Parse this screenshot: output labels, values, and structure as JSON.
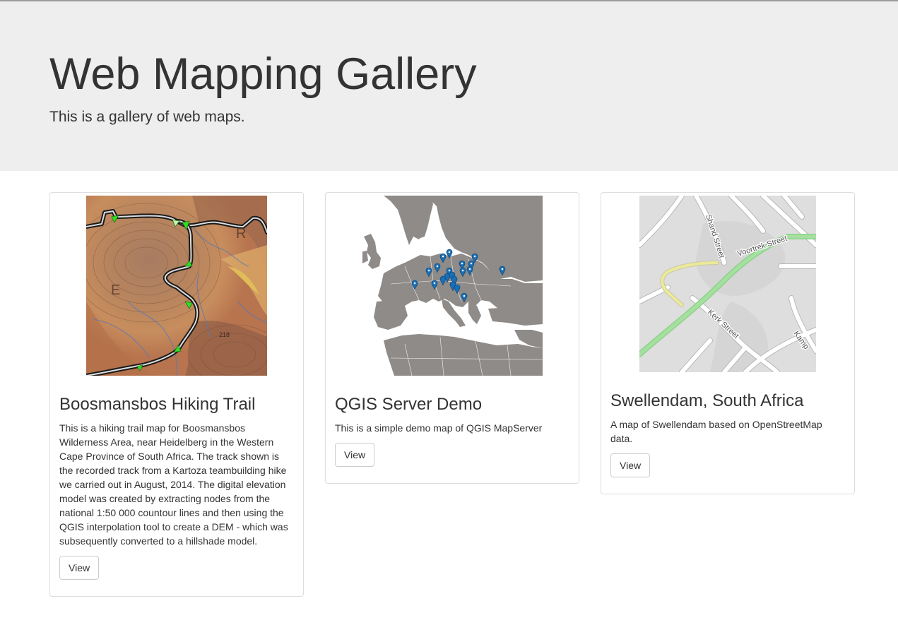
{
  "header": {
    "title": "Web Mapping Gallery",
    "subtitle": "This is a gallery of web maps."
  },
  "cards": [
    {
      "title": "Boosmansbos Hiking Trail",
      "description": "This is a hiking trail map for Boosmansbos Wilderness Area, near Heidelberg in the Western Cape Province of South Africa. The track shown is the recorded track from a Kartoza teambuilding hike we carried out in August, 2014. The digital elevation model was created by extracting nodes from the national 1:50 000 countour lines and then using the QGIS interpolation tool to create a DEM - which was subsequently converted to a hillshade model.",
      "button_label": "View",
      "image_labels": [
        "R",
        "E",
        "218"
      ]
    },
    {
      "title": "QGIS Server Demo",
      "description": "This is a simple demo map of QGIS MapServer",
      "button_label": "View"
    },
    {
      "title": "Swellendam, South Africa",
      "description": "A map of Swellendam based on OpenStreetMap data.",
      "button_label": "View",
      "image_labels": [
        "Shand Street",
        "Voortrek Street",
        "Kerk Street",
        "Kamp"
      ]
    }
  ],
  "colors": {
    "jumbotron_bg": "#eeeeee",
    "text": "#333333",
    "card_border": "#dddddd",
    "button_border": "#cccccc",
    "map_marker": "#1a6fb5",
    "track_marker": "#33dd22"
  }
}
